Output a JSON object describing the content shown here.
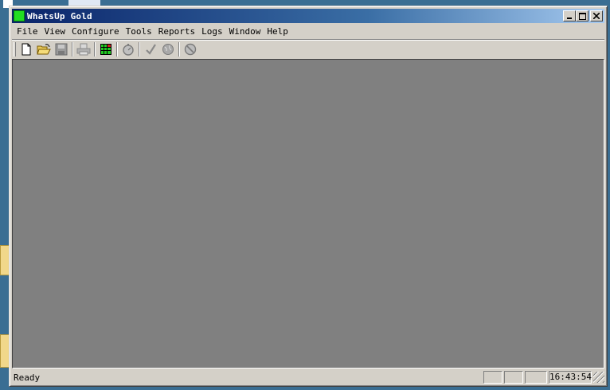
{
  "window": {
    "title": "WhatsUp Gold",
    "app_icon": "green-square-icon",
    "controls": {
      "minimize_icon": "minimize-icon",
      "maximize_icon": "maximize-icon",
      "close_icon": "close-icon"
    }
  },
  "menubar": {
    "items": [
      "File",
      "View",
      "Configure",
      "Tools",
      "Reports",
      "Logs",
      "Window",
      "Help"
    ]
  },
  "toolbar": {
    "buttons": [
      {
        "icon": "new-document-icon",
        "enabled": true
      },
      {
        "icon": "open-folder-icon",
        "enabled": true
      },
      {
        "icon": "save-disk-icon",
        "enabled": false
      },
      {
        "icon": "print-icon",
        "enabled": false
      },
      {
        "icon": "grid-view-icon",
        "enabled": true
      },
      {
        "icon": "stopwatch-icon",
        "enabled": false
      },
      {
        "icon": "check-mark-icon",
        "enabled": false
      },
      {
        "icon": "globe-icon",
        "enabled": false
      },
      {
        "icon": "stop-sign-icon",
        "enabled": false
      }
    ]
  },
  "statusbar": {
    "text": "Ready",
    "clock": "16:43:54"
  },
  "colors": {
    "titlebar_start": "#0a246a",
    "titlebar_end": "#a6caf0",
    "client_background": "#808080",
    "chrome": "#d4d0c8",
    "desktop": "#3a6e93"
  }
}
